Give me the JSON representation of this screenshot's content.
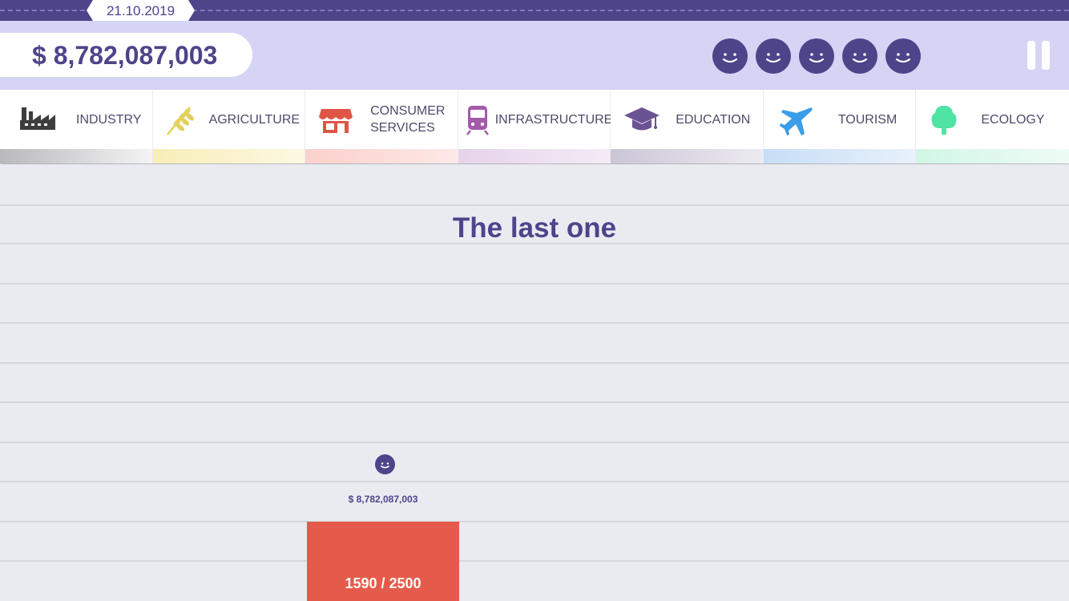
{
  "date": "21.10.2019",
  "money": "$ 8,782,087,003",
  "happiness": {
    "faces": [
      "smiley-icon",
      "smiley-icon",
      "smiley-icon",
      "smiley-icon",
      "smiley-icon"
    ]
  },
  "colors": {
    "brand": "#4d448a",
    "header_band": "#d6d4f5",
    "background": "#e9ebf1",
    "bar_red": "#e55b4b"
  },
  "categories": [
    {
      "label": "INDUSTRY",
      "icon": "factory-icon",
      "color": "#3d3d3d",
      "bar": "#cfcfd1"
    },
    {
      "label": "AGRICULTURE",
      "icon": "wheat-icon",
      "color": "#e2d15a",
      "bar": "#fbf3c6"
    },
    {
      "label": "CONSUMER SERVICES",
      "icon": "store-icon",
      "color": "#e05546",
      "bar": "#fcd8d5"
    },
    {
      "label": "INFRASTRUCTURE",
      "icon": "train-icon",
      "color": "#a35aa8",
      "bar": "#ead8ee"
    },
    {
      "label": "EDUCATION",
      "icon": "graduation-cap-icon",
      "color": "#6b5293",
      "bar": "#d8d3e3"
    },
    {
      "label": "TOURISM",
      "icon": "airplane-icon",
      "color": "#3b9de8",
      "bar": "#cfe4f9"
    },
    {
      "label": "ECOLOGY",
      "icon": "tree-icon",
      "color": "#4fe3a4",
      "bar": "#d8f8eb"
    }
  ],
  "main": {
    "title": "The last one",
    "bar_money": "$ 8,782,087,003",
    "bar_progress": "1590 / 2500",
    "bar_progress_value": 1590,
    "bar_progress_max": 2500
  }
}
